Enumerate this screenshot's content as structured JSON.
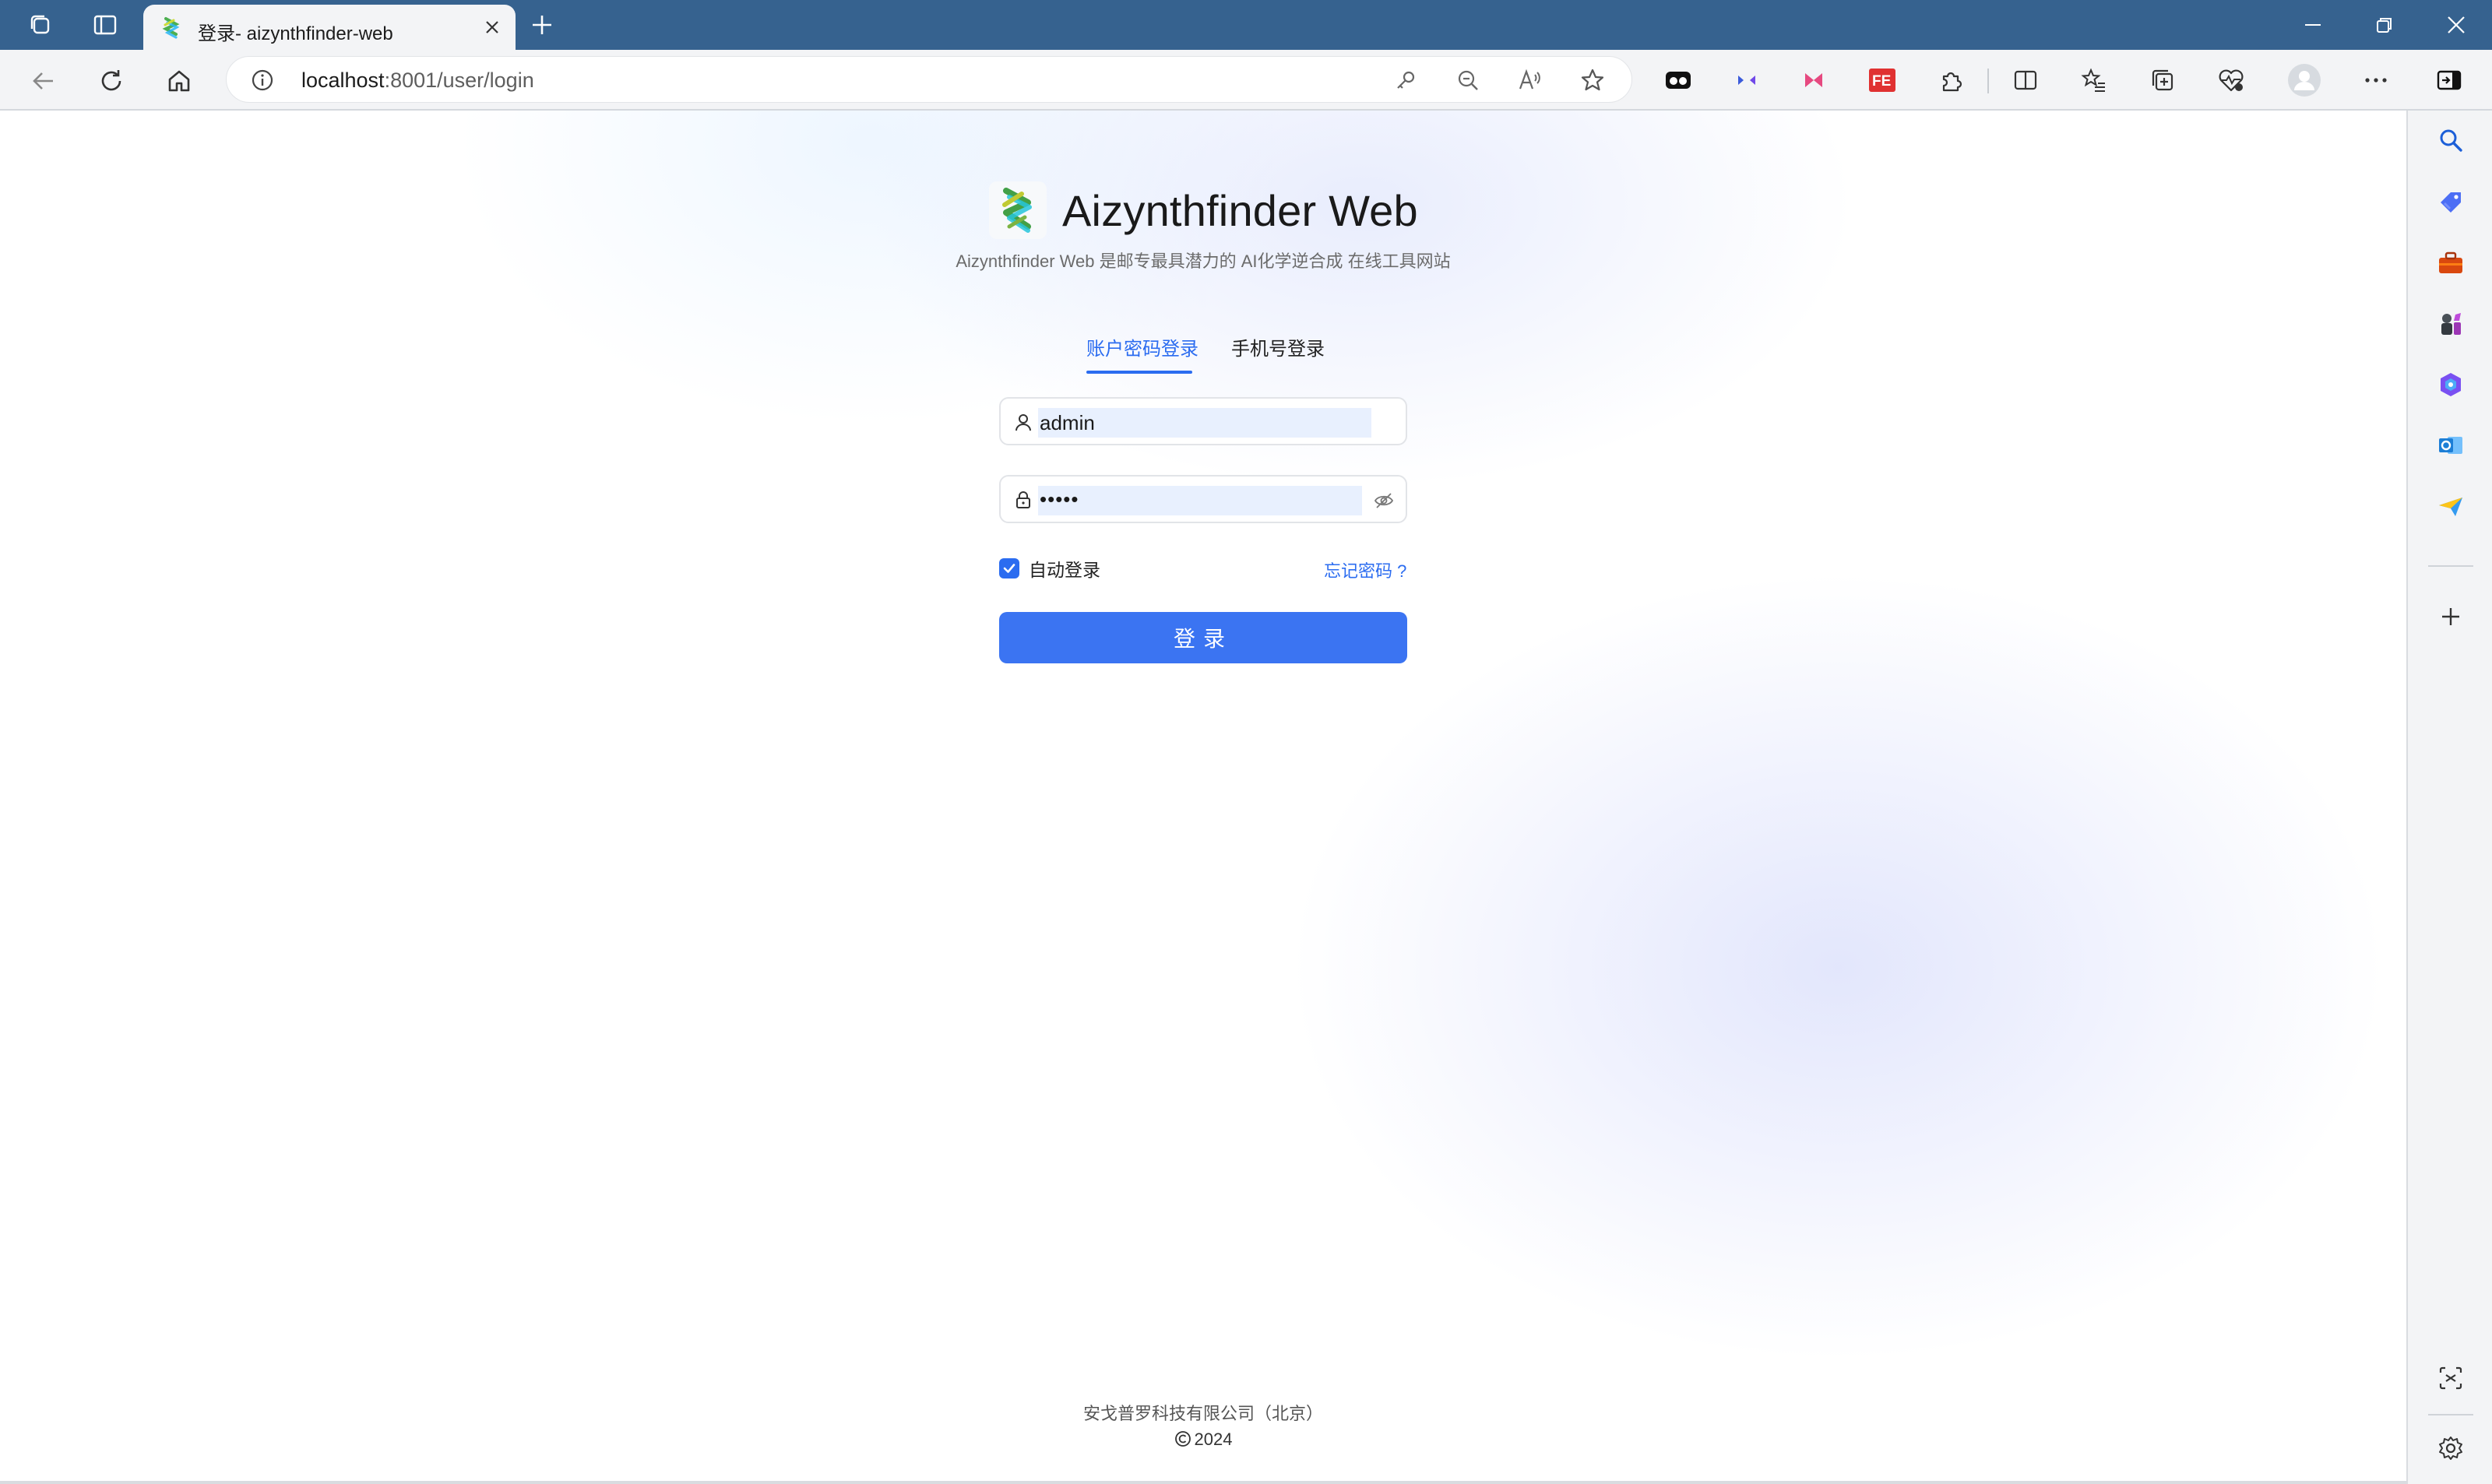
{
  "browser": {
    "tab": {
      "title": "登录- aizynthfinder-web"
    },
    "address": {
      "host": "localhost",
      "path": ":8001/user/login"
    }
  },
  "page": {
    "brand_title": "Aizynthfinder Web",
    "subtitle": "Aizynthfinder Web 是邮专最具潜力的 AI化学逆合成 在线工具网站",
    "tabs": [
      {
        "label": "账户密码登录",
        "active": true
      },
      {
        "label": "手机号登录",
        "active": false
      }
    ],
    "username": {
      "value": "admin"
    },
    "password": {
      "value": "•••••"
    },
    "remember_label": "自动登录",
    "remember_checked": true,
    "forgot_label": "忘记密码 ?",
    "login_button": "登录",
    "footer": {
      "company": "安戈普罗科技有限公司（北京）",
      "copyright": "2024"
    }
  },
  "colors": {
    "titlebar": "#36628f",
    "accent": "#2b6cf0",
    "button": "#3b74f2"
  },
  "icons": {
    "titlebar": [
      "workspaces-icon",
      "tab-actions-icon",
      "favicon-icon",
      "close-icon",
      "new-tab-icon",
      "minimize-icon",
      "restore-icon",
      "window-close-icon"
    ],
    "toolbar": [
      "back-icon",
      "refresh-icon",
      "home-icon",
      "info-icon",
      "key-icon",
      "zoom-out-icon",
      "read-aloud-icon",
      "favorite-star-icon",
      "extension-icon",
      "split-screen-icon",
      "favorites-icon",
      "collections-icon",
      "performance-icon",
      "profile-avatar-icon",
      "more-icon",
      "sidebar-toggle-icon"
    ],
    "sidebar": [
      "search-icon",
      "tag-icon",
      "toolbox-icon",
      "games-icon",
      "copilot-icon",
      "outlook-icon",
      "send-icon",
      "add-icon",
      "screenshot-icon",
      "settings-icon"
    ]
  }
}
